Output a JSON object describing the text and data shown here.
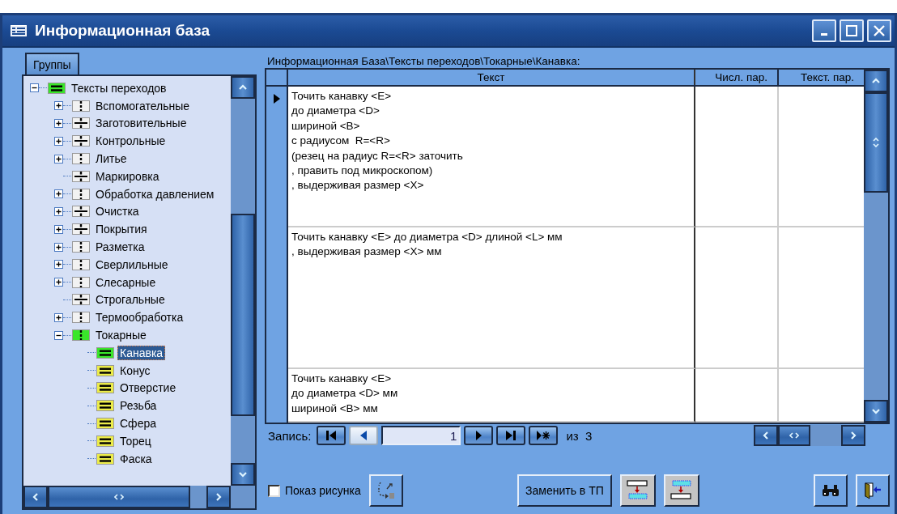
{
  "window": {
    "title": "Информационная база"
  },
  "groups_tab": {
    "label": "Группы"
  },
  "tree": {
    "items": [
      {
        "label": "Тексты переходов",
        "kind": "lines",
        "expanded": true,
        "selected": false,
        "children": [
          {
            "label": "Вспомогательные",
            "kind": "dashed",
            "expanded": false,
            "selected": false
          },
          {
            "label": "Заготовительные",
            "kind": "divided",
            "expanded": false,
            "selected": false
          },
          {
            "label": "Контрольные",
            "kind": "divided",
            "expanded": false,
            "selected": false
          },
          {
            "label": "Литье",
            "kind": "dashed",
            "expanded": false,
            "selected": false
          },
          {
            "label": "Маркировка",
            "kind": "divided",
            "selected": false
          },
          {
            "label": "Обработка давлением",
            "kind": "dashed",
            "expanded": false,
            "selected": false
          },
          {
            "label": "Очистка",
            "kind": "divided",
            "expanded": false,
            "selected": false
          },
          {
            "label": "Покрытия",
            "kind": "divided",
            "expanded": false,
            "selected": false
          },
          {
            "label": "Разметка",
            "kind": "dashed",
            "expanded": false,
            "selected": false
          },
          {
            "label": "Сверлильные",
            "kind": "dashed",
            "expanded": false,
            "selected": false
          },
          {
            "label": "Слесарные",
            "kind": "dashed",
            "expanded": false,
            "selected": false
          },
          {
            "label": "Строгальные",
            "kind": "divided",
            "selected": false
          },
          {
            "label": "Термообработка",
            "kind": "dashed",
            "expanded": false,
            "selected": false
          },
          {
            "label": "Токарные",
            "kind": "dashed",
            "expanded": true,
            "selected": false,
            "children": [
              {
                "label": "Канавка",
                "kind": "lines",
                "selected": true
              },
              {
                "label": "Конус",
                "kind": "lines",
                "selected": false
              },
              {
                "label": "Отверстие",
                "kind": "lines",
                "selected": false
              },
              {
                "label": "Резьба",
                "kind": "lines",
                "selected": false
              },
              {
                "label": "Сфера",
                "kind": "lines",
                "selected": false
              },
              {
                "label": "Торец",
                "kind": "lines",
                "selected": false
              },
              {
                "label": "Фаска",
                "kind": "lines",
                "selected": false
              }
            ]
          }
        ]
      }
    ]
  },
  "path": "Информационная База\\Тексты переходов\\Токарные\\Канавка:",
  "table": {
    "columns": [
      "Текст",
      "Числ. пар.",
      "Текст. пар."
    ],
    "rows": [
      {
        "current": true,
        "text": "Точить канавку <E>\nдо диаметра <D>\nшириной <B>\nс радиусом  R=<R>\n(резец на радиус R=<R> заточить\n, править под микроскопом)\n, выдерживая размер <X>"
      },
      {
        "current": false,
        "text": "Точить канавку <E> до диаметра <D> длиной <L> мм\n, выдерживая размер <X> мм"
      },
      {
        "current": false,
        "text": "Точить канавку <E>\nдо диаметра <D> мм\nшириной <B> мм"
      }
    ]
  },
  "navigator": {
    "label": "Запись:",
    "record": "1",
    "of_label": "из",
    "total": "3"
  },
  "show_picture": {
    "label": "Показ рисунка",
    "checked": false
  },
  "replace_button": {
    "label": "Заменить в ТП"
  }
}
